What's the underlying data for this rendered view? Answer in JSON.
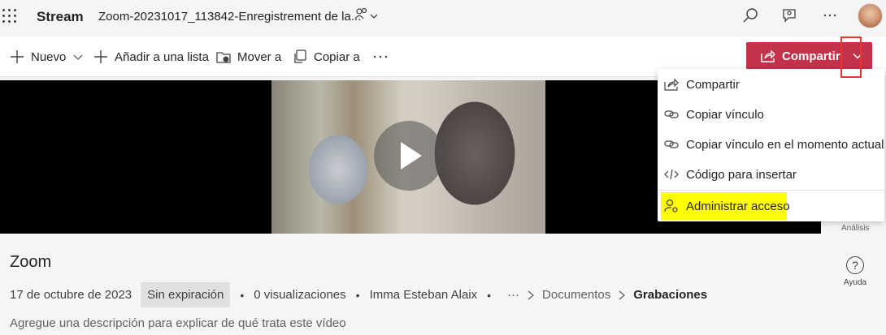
{
  "header": {
    "app_name": "Stream",
    "file_title": "Zoom-20231017_113842-Enregistrement de la...",
    "icons": [
      "waffle-icon",
      "people-icon",
      "chevron-down-icon",
      "search-icon",
      "feedback-icon",
      "more-icon",
      "avatar"
    ]
  },
  "command_bar": {
    "new_label": "Nuevo",
    "add_to_list_label": "Añadir a una lista",
    "move_to_label": "Mover a",
    "copy_to_label": "Copiar a",
    "share_label": "Compartir"
  },
  "share_menu": {
    "items": [
      {
        "label": "Compartir",
        "icon": "share-icon"
      },
      {
        "label": "Copiar vínculo",
        "icon": "link-icon"
      },
      {
        "label": "Copiar vínculo en el momento actual",
        "icon": "link-icon"
      },
      {
        "label": "Código para insertar",
        "icon": "code-icon"
      },
      {
        "label": "Administrar acceso",
        "icon": "person-settings-icon"
      }
    ]
  },
  "side_panel": {
    "analysis_label": "Análisis",
    "help_label": "Ayuda"
  },
  "video": {
    "title": "Zoom",
    "date": "17 de octubre de 2023",
    "expiration_badge": "Sin expiración",
    "views": "0 visualizaciones",
    "author": "Imma Esteban Alaix",
    "breadcrumb_more": "···",
    "breadcrumb": [
      "Documentos",
      "Grabaciones"
    ],
    "description_placeholder": "Agregue una descripción para explicar de qué trata este vídeo"
  },
  "colors": {
    "share_button": "#c4314b",
    "highlight": "#ffff00",
    "annotation_outline": "#e8372b"
  }
}
